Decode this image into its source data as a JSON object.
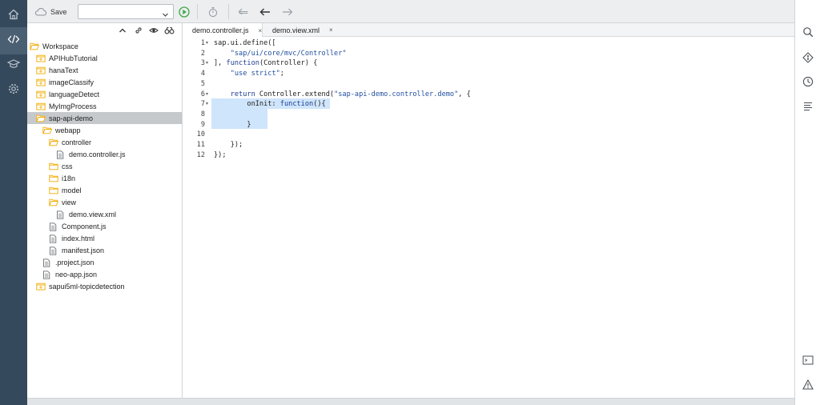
{
  "colors": {
    "rail_bg": "#34495c",
    "accent": "#2a6fb8",
    "run_green": "#3fa845",
    "folder": "#f0ab00",
    "selection": "#c6c9cc",
    "code_highlight": "#cfe5fb"
  },
  "rail": {
    "items": [
      {
        "icon": "home-icon"
      },
      {
        "icon": "code-icon",
        "active": true
      },
      {
        "icon": "learning-icon"
      },
      {
        "icon": "settings-icon"
      }
    ]
  },
  "toolbar": {
    "save_label": "Save",
    "config_select_value": "",
    "icons": [
      "save-cloud-icon",
      "run-icon",
      "debug-icon",
      "undo-icon",
      "back-icon",
      "forward-icon"
    ]
  },
  "tree": {
    "header_icons": [
      "collapse-all-icon",
      "link-editor-icon",
      "show-hidden-icon",
      "binoculars-icon"
    ],
    "nodes": [
      {
        "label": "Workspace",
        "type": "folder-open",
        "depth": 0
      },
      {
        "label": "APIHubTutorial",
        "type": "project",
        "depth": 1
      },
      {
        "label": "hanaText",
        "type": "project",
        "depth": 1
      },
      {
        "label": "imageClassify",
        "type": "project",
        "depth": 1
      },
      {
        "label": "languageDetect",
        "type": "project",
        "depth": 1
      },
      {
        "label": "MyImgProcess",
        "type": "project",
        "depth": 1
      },
      {
        "label": "sap-api-demo",
        "type": "project-open",
        "depth": 1,
        "selected": true
      },
      {
        "label": "webapp",
        "type": "folder-open",
        "depth": 2
      },
      {
        "label": "controller",
        "type": "folder-open",
        "depth": 3
      },
      {
        "label": "demo.controller.js",
        "type": "file",
        "depth": 4
      },
      {
        "label": "css",
        "type": "folder",
        "depth": 3
      },
      {
        "label": "i18n",
        "type": "folder",
        "depth": 3
      },
      {
        "label": "model",
        "type": "folder",
        "depth": 3
      },
      {
        "label": "view",
        "type": "folder-open",
        "depth": 3
      },
      {
        "label": "demo.view.xml",
        "type": "file",
        "depth": 4
      },
      {
        "label": "Component.js",
        "type": "file",
        "depth": 3
      },
      {
        "label": "index.html",
        "type": "file",
        "depth": 3
      },
      {
        "label": "manifest.json",
        "type": "file",
        "depth": 3
      },
      {
        "label": ".project.json",
        "type": "file",
        "depth": 2
      },
      {
        "label": "neo-app.json",
        "type": "file",
        "depth": 2
      },
      {
        "label": "sapui5ml-topicdetection",
        "type": "project",
        "depth": 1
      }
    ]
  },
  "editor": {
    "tabs": [
      {
        "label": "demo.controller.js",
        "active": true,
        "close": "×"
      },
      {
        "label": "demo.view.xml",
        "active": false,
        "close": "×"
      }
    ],
    "lines": [
      {
        "n": "1",
        "fold": "▾",
        "text": "sap.ui.define(["
      },
      {
        "n": "2",
        "fold": "",
        "text": "    \"sap/ui/core/mvc/Controller\""
      },
      {
        "n": "3",
        "fold": "▾",
        "text": "], function(Controller) {"
      },
      {
        "n": "4",
        "fold": "",
        "text": "    \"use strict\";"
      },
      {
        "n": "5",
        "fold": "",
        "text": ""
      },
      {
        "n": "6",
        "fold": "▾",
        "text": "    return Controller.extend(\"sap-api-demo.controller.demo\", {"
      },
      {
        "n": "7",
        "fold": "▾",
        "text": "        onInit: function(){"
      },
      {
        "n": "8",
        "fold": "",
        "text": ""
      },
      {
        "n": "9",
        "fold": "",
        "text": "        }"
      },
      {
        "n": "10",
        "fold": "",
        "text": ""
      },
      {
        "n": "11",
        "fold": "",
        "text": "    });"
      },
      {
        "n": "12",
        "fold": "",
        "text": "});"
      }
    ]
  },
  "right_rail": {
    "icons": [
      "search-icon",
      "git-icon",
      "history-icon",
      "outline-icon",
      "console-icon",
      "problems-icon"
    ]
  }
}
